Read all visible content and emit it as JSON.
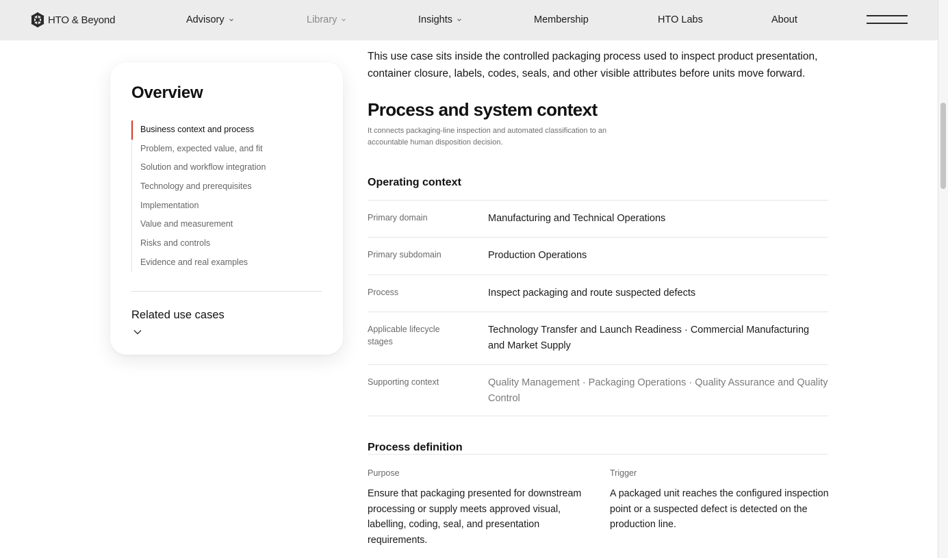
{
  "header": {
    "brand": "HTO & Beyond",
    "nav": [
      {
        "label": "Advisory"
      },
      {
        "label": "Library"
      },
      {
        "label": "Insights"
      },
      {
        "label": "Membership"
      },
      {
        "label": "HTO Labs"
      },
      {
        "label": "About"
      }
    ],
    "menu_icon": "hamburger-menu-icon"
  },
  "overview": {
    "title": "Overview",
    "items": [
      {
        "label": "Business context and process"
      },
      {
        "label": "Problem, expected value, and fit"
      },
      {
        "label": "Solution and workflow integration"
      },
      {
        "label": "Technology and prerequisites"
      },
      {
        "label": "Implementation"
      },
      {
        "label": "Value and measurement"
      },
      {
        "label": "Risks and controls"
      },
      {
        "label": "Evidence and real examples"
      }
    ],
    "active_index": 0,
    "related_label": "Related use cases"
  },
  "content": {
    "intro": "This use case sits inside the controlled packaging process used to inspect product presentation, container closure, labels, codes, seals, and other visible attributes before units move forward.",
    "section_title": "Process and system context",
    "section_note": "It connects packaging-line inspection and automated classification to an accountable human disposition decision.",
    "operating_context": {
      "title": "Operating context",
      "rows": [
        {
          "key": "Primary domain",
          "value": "Manufacturing and Technical Operations"
        },
        {
          "key": "Primary subdomain",
          "value": "Production Operations"
        },
        {
          "key": "Process",
          "value": "Inspect packaging and route suspected defects"
        },
        {
          "key": "Applicable lifecycle stages",
          "value": "Technology Transfer and Launch Readiness · Commercial Manufacturing and Market Supply"
        },
        {
          "key": "Supporting context",
          "value": "Quality Management · Packaging Operations · Quality Assurance and Quality Control"
        }
      ]
    },
    "process_definition": {
      "title": "Process definition",
      "purpose_label": "Purpose",
      "purpose_text": "Ensure that packaging presented for downstream processing or supply meets approved visual, labelling, coding, seal, and presentation requirements.",
      "trigger_label": "Trigger",
      "trigger_text": "A packaged unit reaches the configured inspection point or a suspected defect is detected on the production line."
    }
  },
  "colors": {
    "header_bg": "#ececec",
    "accent": "#d03a2a",
    "muted_text": "#6a6a6a"
  }
}
